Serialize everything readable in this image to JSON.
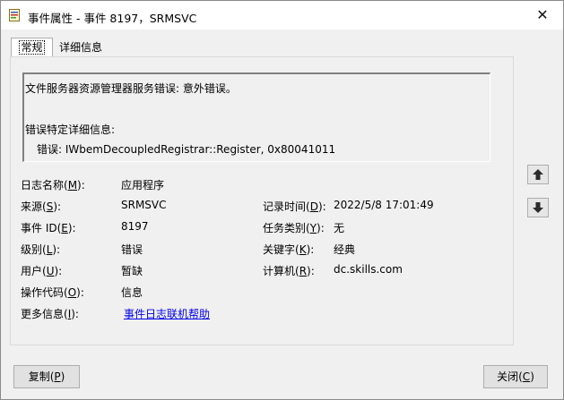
{
  "window": {
    "title": "事件属性 - 事件 8197，SRMSVC",
    "close_glyph": "✕"
  },
  "tabs": [
    {
      "label": "常规"
    },
    {
      "label": "详细信息"
    }
  ],
  "description": {
    "line1": "文件服务器资源管理器服务错误: 意外错误。",
    "line2": "错误特定详细信息:",
    "line3": "错误: IWbemDecoupledRegistrar::Register, 0x80041011"
  },
  "fields": {
    "log_name": {
      "label_pre": "日志名称(",
      "key": "M",
      "label_post": "):",
      "value": "应用程序"
    },
    "source": {
      "label_pre": "来源(",
      "key": "S",
      "label_post": "):",
      "value": "SRMSVC"
    },
    "logged": {
      "label_pre": "记录时间(",
      "key": "D",
      "label_post": "):",
      "value": "2022/5/8 17:01:49"
    },
    "event_id": {
      "label_pre": "事件 ID(",
      "key": "E",
      "label_post": "):",
      "value": "8197"
    },
    "task_category": {
      "label_pre": "任务类别(",
      "key": "Y",
      "label_post": "):",
      "value": "无"
    },
    "level": {
      "label_pre": "级别(",
      "key": "L",
      "label_post": "):",
      "value": "错误"
    },
    "keywords": {
      "label_pre": "关键字(",
      "key": "K",
      "label_post": "):",
      "value": "经典"
    },
    "user": {
      "label_pre": "用户(",
      "key": "U",
      "label_post": "):",
      "value": "暂缺"
    },
    "computer": {
      "label_pre": "计算机(",
      "key": "R",
      "label_post": "):",
      "value": "dc.skills.com"
    },
    "opcode": {
      "label_pre": "操作代码(",
      "key": "O",
      "label_post": "):",
      "value": "信息"
    },
    "more_info": {
      "label_pre": "更多信息(",
      "key": "I",
      "label_post": "):",
      "value": "事件日志联机帮助"
    }
  },
  "buttons": {
    "copy": {
      "pre": "复制(",
      "key": "P",
      "post": ")"
    },
    "close": {
      "pre": "关闭(",
      "key": "C",
      "post": ")"
    }
  }
}
